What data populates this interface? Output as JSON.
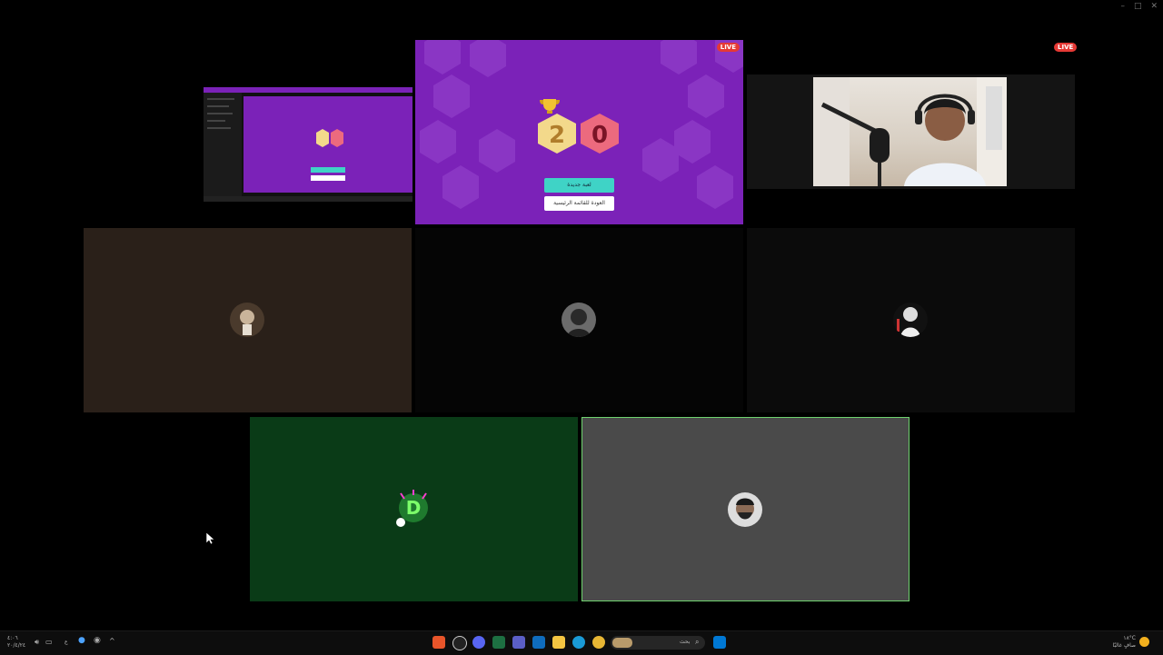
{
  "window": {
    "controls": [
      "–",
      "□",
      "✕"
    ]
  },
  "live_badge": "LIVE",
  "game": {
    "score_left": "2",
    "score_right": "0",
    "btn_primary": "لعبة جديدة",
    "btn_secondary": "العودة للقائمة الرئيسية",
    "colors": {
      "bg": "#7b22b8",
      "left_hex": "#f3d98b",
      "right_hex": "#ec6a7e",
      "primary_btn": "#3fd3c6"
    }
  },
  "taskbar": {
    "clock_time": "٤:٠٦",
    "clock_date": "٢٠/٤/٢٤",
    "lang": "ع",
    "search_text": "بحث",
    "weather_temp": "١٨°C",
    "weather_desc": "صافٍ غالبًا"
  },
  "participants": [
    {
      "name": "screen-share-thumbnail"
    },
    {
      "name": "game-share"
    },
    {
      "name": "webcam-participant"
    },
    {
      "name": "participant-brown"
    },
    {
      "name": "participant-dark-1"
    },
    {
      "name": "participant-dark-2"
    },
    {
      "name": "participant-green"
    },
    {
      "name": "participant-gray-speaking"
    }
  ]
}
